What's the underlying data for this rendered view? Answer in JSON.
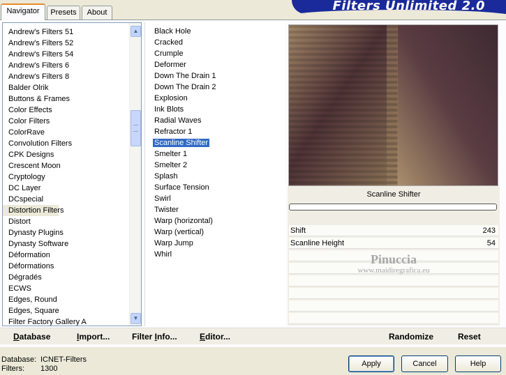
{
  "tabs": [
    {
      "label": "Navigator",
      "active": true
    },
    {
      "label": "Presets",
      "active": false
    },
    {
      "label": "About",
      "active": false
    }
  ],
  "app_title": "Filters Unlimited 2.0",
  "categories": [
    "Andrew's Filters 51",
    "Andrew's Filters 52",
    "Andrew's Filters 54",
    "Andrew's Filters 6",
    "Andrew's Filters 8",
    "Balder Olrik",
    "Buttons & Frames",
    "Color Effects",
    "Color Filters",
    "ColorRave",
    "Convolution Filters",
    "CPK Designs",
    "Crescent Moon",
    "Cryptology",
    "DC Layer",
    "DCspecial",
    "Distortion Filters",
    "Distort",
    "Dynasty Plugins",
    "Dynasty Software",
    "Déformation",
    "Déformations",
    "Dégradés",
    "ECWS",
    "Edges, Round",
    "Edges, Square",
    "Filter Factory Gallery A"
  ],
  "selected_category": "Distortion Filters",
  "filters": [
    "Black Hole",
    "Cracked",
    "Crumple",
    "Deformer",
    "Down The Drain 1",
    "Down The Drain 2",
    "Explosion",
    "Ink Blots",
    "Radial Waves",
    "Refractor 1",
    "Scanline Shifter",
    "Smelter 1",
    "Smelter 2",
    "Splash",
    "Surface Tension",
    "Swirl",
    "Twister",
    "Warp (horizontal)",
    "Warp (vertical)",
    "Warp Jump",
    "Whirl"
  ],
  "selected_filter": "Scanline Shifter",
  "filter_name": "Scanline Shifter",
  "params": [
    {
      "name": "Shift",
      "value": "243"
    },
    {
      "name": "Scanline Height",
      "value": "54"
    }
  ],
  "watermark": {
    "line1": "Pinuccia",
    "line2": "www.maidiregrafica.eu"
  },
  "bottom_bar": {
    "database": "Database",
    "import": "Import...",
    "filter_info": "Filter Info...",
    "editor": "Editor...",
    "randomize": "Randomize",
    "reset": "Reset"
  },
  "status": {
    "database_key": "Database:",
    "database_value": "ICNET-Filters",
    "filters_key": "Filters:",
    "filters_value": "1300"
  },
  "buttons": {
    "apply": "Apply",
    "cancel": "Cancel",
    "help": "Help"
  },
  "colors": {
    "selection": "#316ac5",
    "banner": "#1a2a9a",
    "preview_dark": "#4a3038",
    "preview_light": "#a8906c"
  }
}
